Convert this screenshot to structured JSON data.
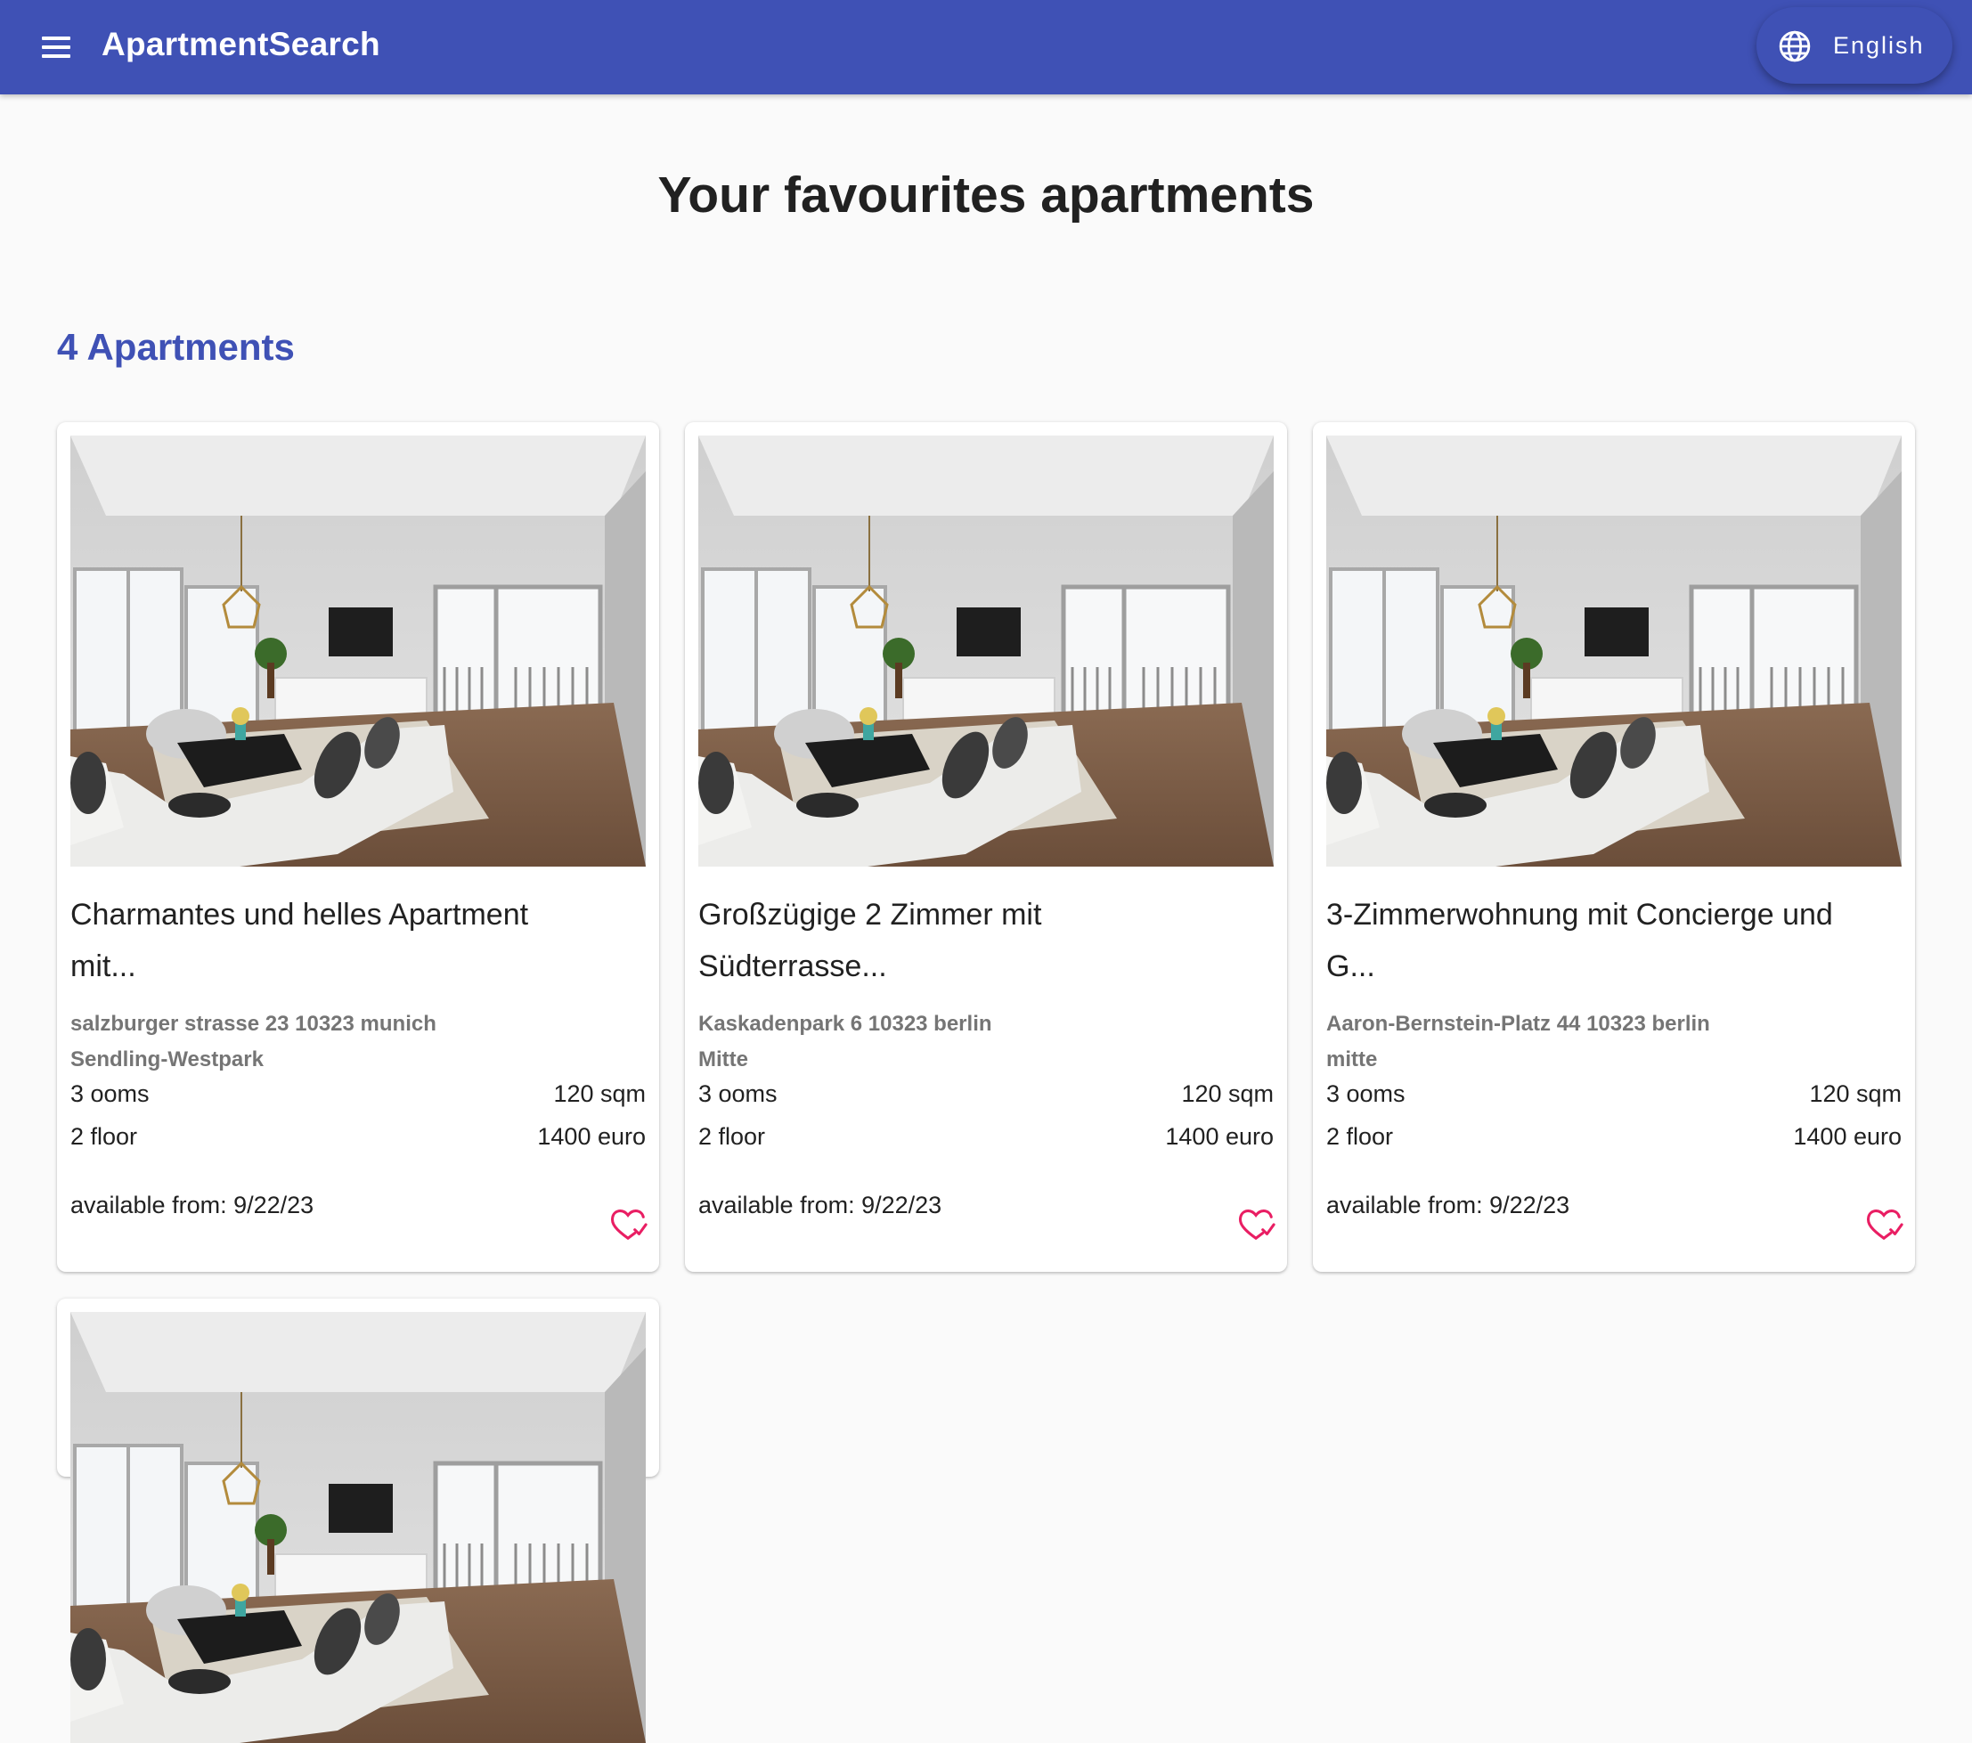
{
  "appbar": {
    "title": "ApartmentSearch",
    "language": "English",
    "menu_icon": "hamburger-menu-icon",
    "language_icon": "globe-icon",
    "color": "#3f51b5"
  },
  "page": {
    "title": "Your favourites apartments",
    "count_label": "4 Apartments"
  },
  "colors": {
    "favorite": "#e91e63",
    "muted": "#757575"
  },
  "apartments": [
    {
      "title_line1": "Charmantes und helles Apartment",
      "title_line2": "mit...",
      "address_line1": "salzburger strasse 23 10323 munich",
      "address_line2": "Sendling-Westpark",
      "rooms": "3 ooms",
      "size": "120 sqm",
      "floor": "2 floor",
      "price": "1400 euro",
      "available": "available from: 9/22/23"
    },
    {
      "title_line1": "Großzügige 2 Zimmer mit",
      "title_line2": "Südterrasse...",
      "address_line1": "Kaskadenpark 6 10323 berlin",
      "address_line2": "Mitte",
      "rooms": "3 ooms",
      "size": "120 sqm",
      "floor": "2 floor",
      "price": "1400 euro",
      "available": "available from: 9/22/23"
    },
    {
      "title_line1": "3-Zimmerwohnung mit Concierge und",
      "title_line2": "G...",
      "address_line1": "Aaron-Bernstein-Platz 44 10323 berlin",
      "address_line2": "mitte",
      "rooms": "3 ooms",
      "size": "120 sqm",
      "floor": "2 floor",
      "price": "1400 euro",
      "available": "available from: 9/22/23"
    }
  ]
}
